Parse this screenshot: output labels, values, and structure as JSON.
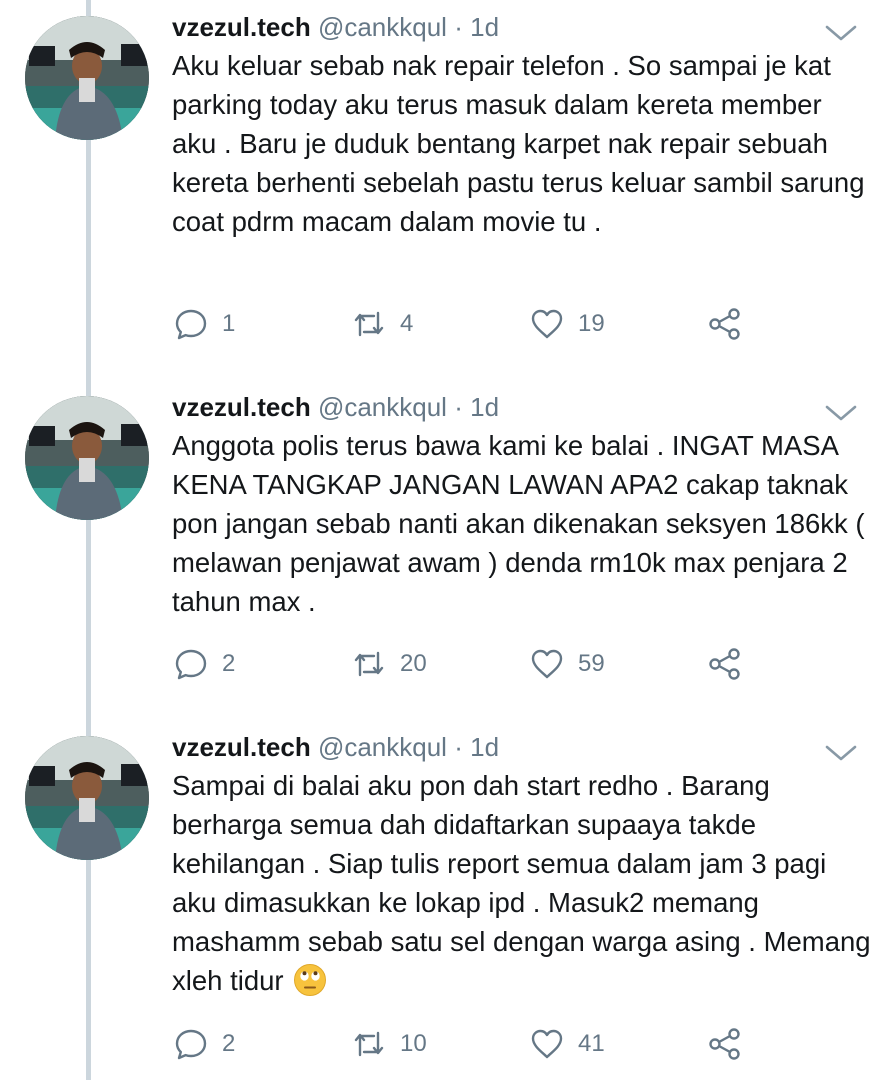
{
  "tweets": [
    {
      "name": "vzezul.tech",
      "handle": "@cankkqul",
      "separator": "·",
      "time": "1d",
      "text": "Aku keluar sebab nak repair telefon . So sampai je kat parking today aku terus masuk dalam kereta member aku . Baru je duduk bentang karpet nak repair sebuah kereta berhenti sebelah pastu terus keluar sambil sarung coat pdrm macam dalam movie tu .",
      "replies": "1",
      "retweets": "4",
      "likes": "19"
    },
    {
      "name": "vzezul.tech",
      "handle": "@cankkqul",
      "separator": "·",
      "time": "1d",
      "text": "Anggota polis terus bawa kami ke balai . INGAT MASA KENA TANGKAP JANGAN LAWAN APA2 cakap taknak pon jangan sebab nanti akan dikenakan seksyen 186kk ( melawan penjawat awam ) denda rm10k max penjara 2 tahun max .",
      "replies": "2",
      "retweets": "20",
      "likes": "59"
    },
    {
      "name": "vzezul.tech",
      "handle": "@cankkqul",
      "separator": "·",
      "time": "1d",
      "text": "Sampai di balai aku pon dah start redho . Barang berharga semua dah didaftarkan supaaya takde kehilangan . Siap tulis report semua dalam jam 3 pagi aku dimasukkan ke lokap ipd . Masuk2 memang mashamm sebab satu sel dengan warga asing . Memang xleh tidur",
      "replies": "2",
      "retweets": "10",
      "likes": "41",
      "trailing_emoji": "face-with-rolling-eyes"
    }
  ],
  "icons": {
    "reply": "reply-icon",
    "retweet": "retweet-icon",
    "like": "heart-icon",
    "share": "share-icon",
    "menu": "chevron-down-icon"
  },
  "colors": {
    "text": "#14171a",
    "muted": "#657786",
    "thread_line": "#ccd6dd"
  }
}
